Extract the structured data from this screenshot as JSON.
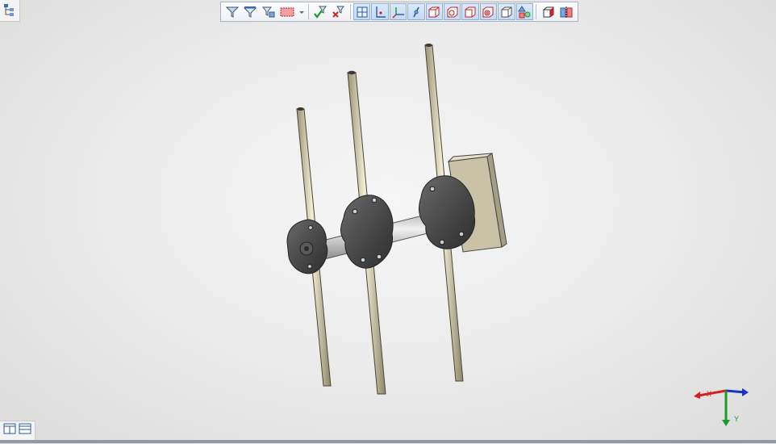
{
  "window": {
    "tree_toggle_icon": "feature-tree-icon"
  },
  "toolbar": {
    "groups": [
      [
        "filter-icon",
        "filter-edges-icon",
        "filter-faces-icon",
        "selection-box-icon",
        "dropdown-arrow-icon"
      ],
      [
        "accept-filter-icon",
        "clear-filter-icon"
      ],
      [
        "plane-icon",
        "axis-icon",
        "coordinate-system-icon",
        "point-icon",
        "box-icon",
        "cylinder-icon",
        "cube-icon",
        "torus-icon",
        "sphere-icon",
        "shapes-icon"
      ],
      [
        "display-icon",
        "section-view-icon"
      ]
    ]
  },
  "triad": {
    "x_label": "X",
    "y_label": "Y",
    "colors": {
      "x": "#d42020",
      "y": "#1a9a2a",
      "z": "#1a30c8"
    }
  },
  "bottom_panel": {
    "icons": [
      "single-view-icon",
      "split-view-icon"
    ]
  }
}
